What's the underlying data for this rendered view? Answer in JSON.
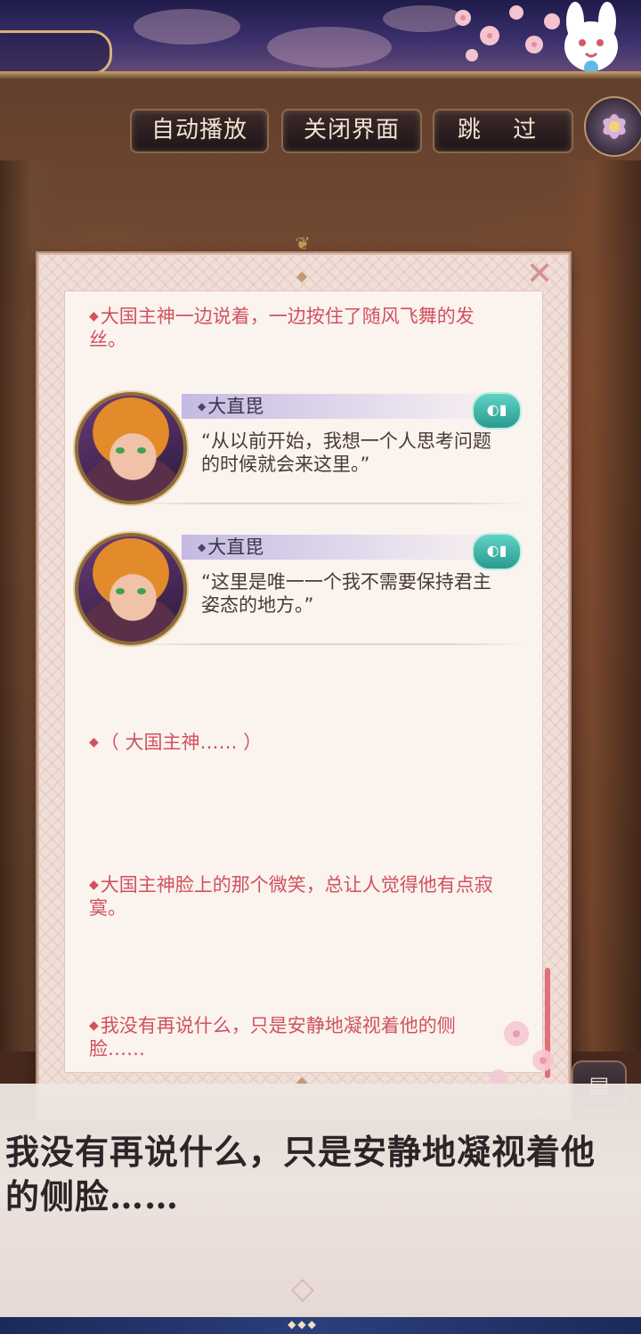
{
  "toolbar": {
    "auto_play_label": "自动播放",
    "close_ui_label": "关闭界面",
    "skip_label": "跳 过"
  },
  "log": {
    "close_label": "✕",
    "entries": [
      {
        "type": "narration",
        "text": "大国主神一边说着，一边按住了随风飞舞的发丝。"
      },
      {
        "type": "dialogue",
        "speaker": "大直毘",
        "text": "“从以前开始，我想一个人思考问题的时候就会来这里。”"
      },
      {
        "type": "dialogue",
        "speaker": "大直毘",
        "text": "“这里是唯一一个我不需要保持君主姿态的地方。”"
      },
      {
        "type": "narration",
        "text": "（ 大国主神…… ）"
      },
      {
        "type": "narration",
        "text": "大国主神脸上的那个微笑，总让人觉得他有点寂寞。"
      },
      {
        "type": "narration",
        "text": "我没有再说什么，只是安静地凝视着他的侧脸……"
      }
    ]
  },
  "dialogue_box": {
    "text": "我没有再说什么，只是安静地凝视着他的侧脸……"
  },
  "icons": {
    "voice": "speaker-icon",
    "log": "log-icon",
    "menu": "flower-menu-icon"
  },
  "colors": {
    "narration_text": "#d0525f",
    "voice_button": "#3fbfb0",
    "panel_bg": "#fbf3ee"
  }
}
